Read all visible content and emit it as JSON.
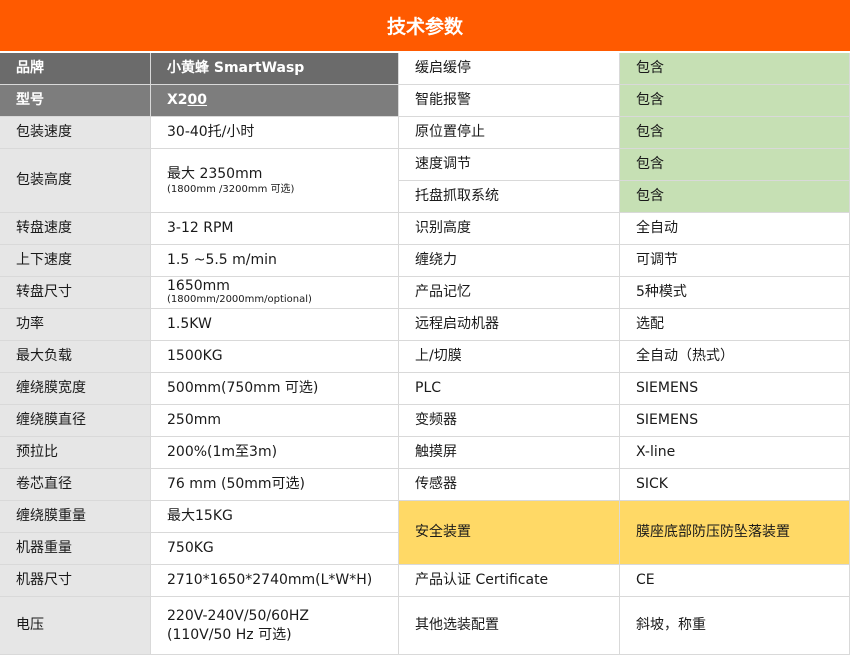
{
  "title": "技术参数",
  "header": {
    "brand_label": "品牌",
    "brand_value": "小黄蜂 SmartWasp",
    "model_label": "型号",
    "model_value_prefix": "X2",
    "model_value_underlined": "00"
  },
  "left_specs": [
    {
      "label": "包装速度",
      "value": "30-40托/小时"
    },
    {
      "label": "包装高度",
      "value": "最大 2350mm",
      "note": "(1800mm /3200mm 可选)"
    },
    {
      "label": "转盘速度",
      "value": "3-12 RPM"
    },
    {
      "label": "上下速度",
      "value": "1.5 ~5.5 m/min"
    },
    {
      "label": "转盘尺寸",
      "value": "1650mm",
      "note": "(1800mm/2000mm/optional)"
    },
    {
      "label": "功率",
      "value": "1.5KW"
    },
    {
      "label": "最大负载",
      "value": "1500KG"
    },
    {
      "label": "缠绕膜宽度",
      "value": "500mm(750mm 可选)"
    },
    {
      "label": "缠绕膜直径",
      "value": "250mm"
    },
    {
      "label": "预拉比",
      "value": "200%(1m至3m)"
    },
    {
      "label": "卷芯直径",
      "value": "76 mm (50mm可选)"
    },
    {
      "label": "缠绕膜重量",
      "value": "最大15KG"
    },
    {
      "label": "机器重量",
      "value": "750KG"
    },
    {
      "label": "机器尺寸",
      "value": "2710*1650*2740mm(L*W*H)"
    },
    {
      "label": "电压",
      "value": "220V-240V/50/60HZ",
      "value2": "(110V/50 Hz 可选)"
    }
  ],
  "right_specs": [
    {
      "label": "缓启缓停",
      "value": "包含"
    },
    {
      "label": "智能报警",
      "value": "包含"
    },
    {
      "label": "原位置停止",
      "value": "包含"
    },
    {
      "label": "速度调节",
      "value": "包含"
    },
    {
      "label": "托盘抓取系统",
      "value": "包含"
    },
    {
      "label": "识别高度",
      "value": "全自动"
    },
    {
      "label": "缠绕力",
      "value": "可调节"
    },
    {
      "label": "产品记忆",
      "value": "5种模式"
    },
    {
      "label": "远程启动机器",
      "value": "选配"
    },
    {
      "label": "上/切膜",
      "value": "全自动（热式）"
    },
    {
      "label": "PLC",
      "value": "SIEMENS"
    },
    {
      "label": "变频器",
      "value": "SIEMENS"
    },
    {
      "label": "触摸屏",
      "value": "X-line"
    },
    {
      "label": "传感器",
      "value": "SICK"
    },
    {
      "label": "安全装置",
      "value": "膜座底部防压防坠落装置"
    },
    {
      "label": "产品认证 Certificate",
      "value": "CE"
    },
    {
      "label": "其他选装配置",
      "value": "斜坡，称重"
    }
  ],
  "colors": {
    "title_bg": "#ff5a00",
    "header_bg": "#6b6b6b",
    "label_bg": "#e6e6e6",
    "included_bg": "#c6e0b4",
    "safety_bg": "#ffd966"
  }
}
